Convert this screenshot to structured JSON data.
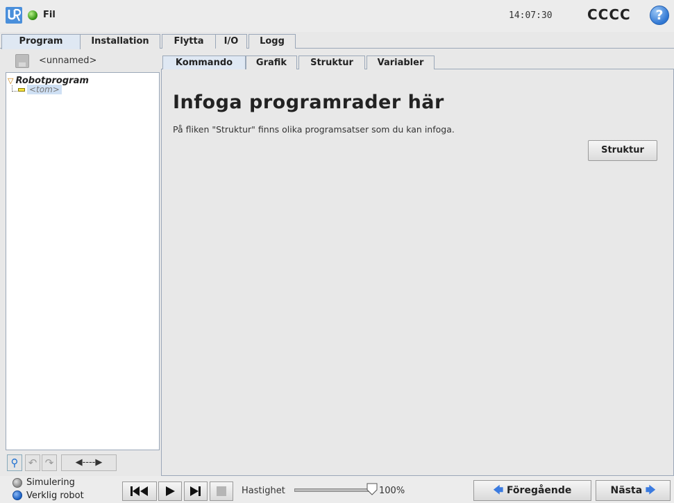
{
  "topbar": {
    "menu_label": "Fil",
    "clock": "14:07:30",
    "robot_name": "CCCC",
    "help_glyph": "?"
  },
  "main_tabs": [
    {
      "label": "Program",
      "active": true
    },
    {
      "label": "Installation",
      "active": false
    },
    {
      "label": "Flytta",
      "active": false
    },
    {
      "label": "I/O",
      "active": false
    },
    {
      "label": "Logg",
      "active": false
    }
  ],
  "program": {
    "file_name": "<unnamed>",
    "tree_root": "Robotprogram",
    "tree_child": "<tom>"
  },
  "tree_tools": {
    "move_glyph": "◀----▶"
  },
  "sub_tabs": [
    {
      "label": "Kommando",
      "active": true
    },
    {
      "label": "Grafik",
      "active": false
    },
    {
      "label": "Struktur",
      "active": false
    },
    {
      "label": "Variabler",
      "active": false
    }
  ],
  "content": {
    "heading": "Infoga programrader här",
    "info": "På fliken \"Struktur\" finns olika programsatser som du kan infoga.",
    "button_label": "Struktur"
  },
  "bottombar": {
    "mode_simulation": "Simulering",
    "mode_real": "Verklig robot",
    "selected_mode": "Verklig robot",
    "speed_label": "Hastighet",
    "speed_value": "100%",
    "speed_fraction": 1.0,
    "prev_label": "Föregående",
    "next_label": "Nästa"
  },
  "colors": {
    "accent_blue": "#1d6fd1",
    "status_green": "#3d9b1a",
    "tab_border": "#9aa7b8"
  },
  "icons": [
    "ur-logo-icon",
    "status-ok-icon",
    "help-icon",
    "save-icon",
    "search-icon",
    "undo-icon",
    "redo-icon",
    "move-arrows-icon",
    "skip-first-icon",
    "play-icon",
    "step-icon",
    "stop-icon",
    "arrow-left-icon",
    "arrow-right-icon"
  ]
}
